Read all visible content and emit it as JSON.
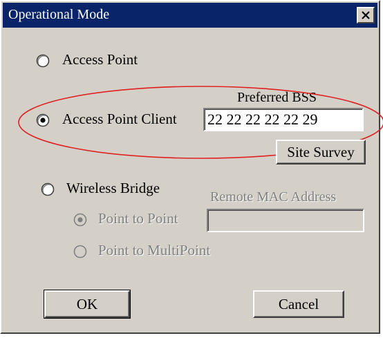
{
  "window": {
    "title": "Operational Mode"
  },
  "options": {
    "access_point": {
      "label": "Access Point",
      "selected": false
    },
    "access_point_client": {
      "label": "Access Point Client",
      "selected": true
    },
    "wireless_bridge": {
      "label": "Wireless Bridge",
      "selected": false
    },
    "point_to_point": {
      "label": "Point to Point",
      "selected": true,
      "enabled": false
    },
    "point_to_multipoint": {
      "label": "Point to MultiPoint",
      "selected": false,
      "enabled": false
    }
  },
  "preferred_bss": {
    "label": "Preferred BSS",
    "value": "22 22 22 22 22 29"
  },
  "site_survey": {
    "label": "Site Survey"
  },
  "remote_mac": {
    "label": "Remote MAC Address",
    "value": ""
  },
  "buttons": {
    "ok": "OK",
    "cancel": "Cancel"
  },
  "colors": {
    "titlebar": "#0a246a",
    "face": "#d4d0c8",
    "highlight_ellipse": "#e02020",
    "disabled_text": "#808080"
  }
}
